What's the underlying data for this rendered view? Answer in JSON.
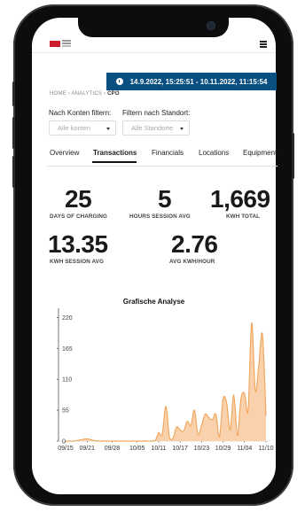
{
  "breadcrumb": {
    "home": "HOME",
    "sep1": "›",
    "analytics": "ANALYTICS",
    "sep2": "›",
    "current": "CPO"
  },
  "date_range": "14.9.2022, 15:25:51 - 10.11.2022, 11:15:54",
  "filters": [
    {
      "label": "Nach Konten filtern:",
      "placeholder": "Alle konten"
    },
    {
      "label": "Filtern nach Standort:",
      "placeholder": "Alle Standorte"
    }
  ],
  "tabs": [
    {
      "label": "Overview",
      "active": false
    },
    {
      "label": "Transactions",
      "active": true
    },
    {
      "label": "Financials",
      "active": false
    },
    {
      "label": "Locations",
      "active": false
    },
    {
      "label": "Equipment",
      "active": false
    }
  ],
  "kpis": [
    {
      "value": "25",
      "label": "DAYS OF CHARGING"
    },
    {
      "value": "5",
      "label": "HOURS SESSION AVG"
    },
    {
      "value": "1,669",
      "label": "KWH TOTAL"
    },
    {
      "value": "13.35",
      "label": "KWH SESSION AVG"
    },
    {
      "value": "2.76",
      "label": "AVG KWH/HOUR"
    }
  ],
  "colors": {
    "accent": "#0a4f82",
    "chart_fill": "#f9d2ad",
    "chart_line": "#f0a75f"
  },
  "chart_data": {
    "type": "area",
    "title": "Grafische Analyse",
    "x_tick_labels": [
      "09/15",
      "09/21",
      "09/28",
      "10/05",
      "10/11",
      "10/17",
      "10/23",
      "10/29",
      "11/04",
      "11/10"
    ],
    "y_ticks": [
      0,
      55,
      110,
      165,
      220
    ],
    "ylim": [
      0,
      230
    ],
    "x": [
      "09/15",
      "09/17",
      "09/19",
      "09/21",
      "09/23",
      "09/25",
      "09/28",
      "10/01",
      "10/05",
      "10/08",
      "10/10",
      "10/11",
      "10/12",
      "10/13",
      "10/14",
      "10/15",
      "10/16",
      "10/17",
      "10/18",
      "10/19",
      "10/20",
      "10/21",
      "10/22",
      "10/23",
      "10/24",
      "10/25",
      "10/26",
      "10/27",
      "10/28",
      "10/29",
      "10/30",
      "10/31",
      "11/01",
      "11/02",
      "11/03",
      "11/04",
      "11/05",
      "11/06",
      "11/07",
      "11/08",
      "11/09",
      "11/10"
    ],
    "y": [
      0,
      0,
      2,
      4,
      1,
      0,
      0,
      0,
      0,
      0,
      1,
      15,
      12,
      62,
      8,
      5,
      25,
      20,
      18,
      35,
      28,
      55,
      12,
      28,
      48,
      42,
      38,
      48,
      8,
      75,
      68,
      20,
      82,
      10,
      75,
      85,
      55,
      210,
      90,
      135,
      190,
      45
    ]
  }
}
